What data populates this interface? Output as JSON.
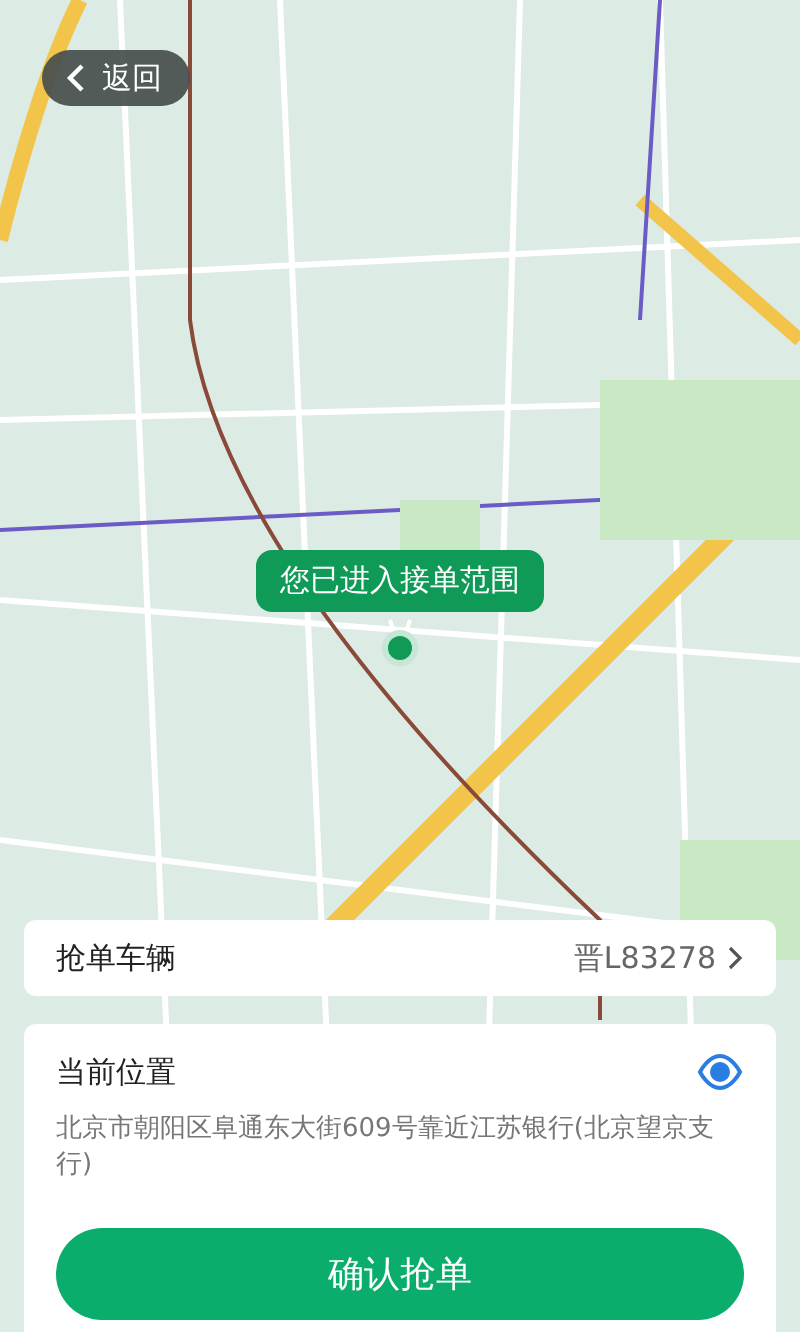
{
  "back_button": {
    "label": "返回"
  },
  "map": {
    "range_tip": "您已进入接单范围"
  },
  "vehicle": {
    "label": "抢单车辆",
    "plate": "晋L83278"
  },
  "location": {
    "label": "当前位置",
    "address": "北京市朝阳区阜通东大街609号靠近江苏银行(北京望京支行)"
  },
  "confirm_button": {
    "label": "确认抢单"
  }
}
